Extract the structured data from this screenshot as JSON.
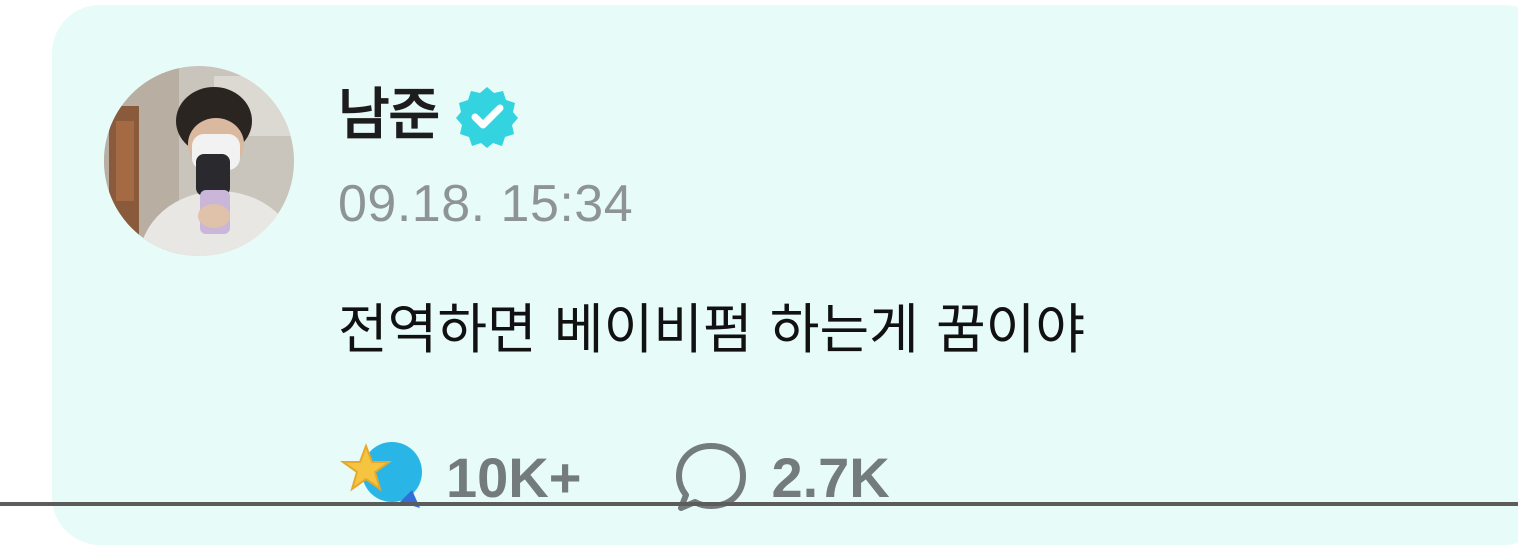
{
  "post": {
    "author": {
      "name": "남준",
      "verified_icon": "verified-badge-icon",
      "avatar_icon": "user-avatar-photo"
    },
    "timestamp": "09.18. 15:34",
    "text": "전역하면 베이비펌 하는게 꿈이야",
    "reactions": {
      "like_icon": "star-sticker-icon",
      "like_count": "10K+",
      "comment_icon": "comment-bubble-icon",
      "comment_count": "2.7K"
    }
  },
  "colors": {
    "card_background": "#e7fbf9",
    "verified_badge": "#34d3e0",
    "timestamp_text": "#8e9496",
    "count_text": "#737b7c",
    "like_star": "#f5c542",
    "like_bubble": "#29b6e6"
  }
}
